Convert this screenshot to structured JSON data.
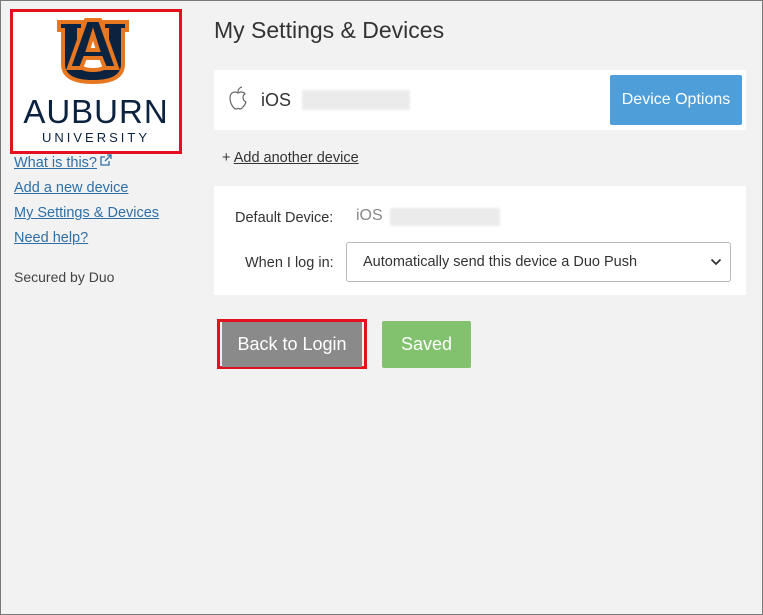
{
  "sidebar": {
    "logo": {
      "wordmark": "AUBURN",
      "subtitle": "UNIVERSITY",
      "navy": "#0c2340",
      "orange": "#e87722"
    },
    "links": {
      "what_is_this": "What is this?",
      "add_new_device": "Add a new device",
      "my_settings": "My Settings & Devices",
      "need_help": "Need help?"
    },
    "secured_by": "Secured by Duo"
  },
  "main": {
    "title": "My Settings & Devices",
    "device": {
      "icon": "apple-icon",
      "name": "iOS",
      "options_label": "Device Options"
    },
    "add_another_prefix": "+",
    "add_another_label": "Add another device",
    "settings": {
      "default_device_label": "Default Device:",
      "default_device_value": "iOS",
      "login_label": "When I log in:",
      "login_selected": "Automatically send this device a Duo Push"
    },
    "buttons": {
      "back_to_login": "Back to Login",
      "saved": "Saved"
    }
  },
  "colors": {
    "highlight": "#e4101d",
    "primary_button": "#4d9ed9",
    "back_button": "#8a8a8a",
    "saved_button": "#82c26e",
    "link": "#2f6fa6"
  }
}
